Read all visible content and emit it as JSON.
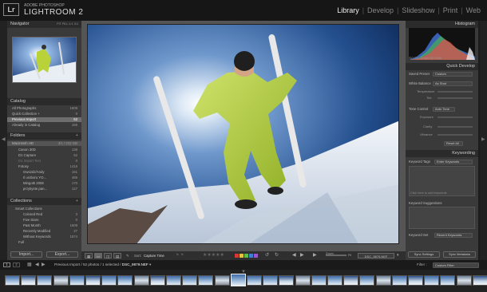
{
  "app": {
    "brand_sub": "ADOBE PHOTOSHOP",
    "brand_main": "LIGHTROOM 2",
    "logo": "Lr"
  },
  "modules": [
    "Library",
    "Develop",
    "Slideshow",
    "Print",
    "Web"
  ],
  "left_panel": {
    "navigator": {
      "title": "Navigator",
      "zoom_options": "FIT FILL 1:1 3:1"
    },
    "catalog": {
      "title": "Catalog",
      "items": [
        {
          "label": "All Photographs",
          "count": "1609"
        },
        {
          "label": "Quick Collection +",
          "count": "0"
        },
        {
          "label": "Previous Import",
          "count": "52"
        },
        {
          "label": "Already in Catalog",
          "count": "168"
        }
      ]
    },
    "folders": {
      "title": "Folders",
      "volume": {
        "label": "Macintosh HD",
        "info": "3/1 / 232 GB"
      },
      "items": [
        {
          "label": "Canon 30D",
          "count": "138"
        },
        {
          "label": "D1 Capture",
          "count": "52"
        },
        {
          "label": "D1 Import Test",
          "count": "0"
        },
        {
          "label": "Fotosy",
          "count": "1416"
        },
        {
          "label": "Gwozdz/Andy",
          "count": "161"
        },
        {
          "label": "Il uroboru YO...",
          "count": "486"
        },
        {
          "label": "Mingotti 2008",
          "count": "170"
        },
        {
          "label": "przykyste.pan...",
          "count": "127"
        }
      ]
    },
    "collections": {
      "title": "Collections",
      "items": [
        {
          "label": "Smart Collections",
          "count": ""
        },
        {
          "label": "Colored Red",
          "count": "3"
        },
        {
          "label": "Five Stars",
          "count": "0"
        },
        {
          "label": "Past Month",
          "count": "1609"
        },
        {
          "label": "Recently Modified",
          "count": "27"
        },
        {
          "label": "Without Keywords",
          "count": "1574"
        },
        {
          "label": "Full",
          "count": ""
        }
      ]
    },
    "import_button": "Import...",
    "export_button": "Export..."
  },
  "right_panel": {
    "histogram": {
      "title": "Histogram",
      "info": "ISO 200   24 mm   f/10   1/250"
    },
    "quick_develop": {
      "title": "Quick Develop",
      "saved_preset_label": "Saved Preset",
      "saved_preset_value": "Custom",
      "white_balance_label": "White Balance",
      "white_balance_value": "As Shot",
      "temperature_label": "Temperature",
      "tint_label": "Tint",
      "tone_control_label": "Tone Control",
      "auto_tone": "Auto Tone",
      "exposure_label": "Exposure",
      "clarity_label": "Clarity",
      "vibrance_label": "Vibrance",
      "reset_all": "Reset All"
    },
    "keywording": {
      "title": "Keywording",
      "keyword_tags_label": "Keyword Tags",
      "keyword_tags_value": "Enter Keywords",
      "add_keywords_placeholder": "Click here to add keywords",
      "keyword_suggestions_label": "Keyword Suggestions",
      "keyword_set_label": "Keyword Set",
      "keyword_set_value": "Recent Keywords"
    },
    "sync_settings": "Sync Settings",
    "sync_metadata": "Sync Metadata"
  },
  "toolbar": {
    "sort_label": "Sort:",
    "sort_value": "Capture Time",
    "zoom_label": "Zoom",
    "zoom_value": "Fit",
    "filename": "DSC_9879.NEF",
    "color_labels": [
      "#d23a3a",
      "#e3c33b",
      "#5dbb4a",
      "#3d7fd4",
      "#9a57c9"
    ]
  },
  "filmstrip": {
    "page1": "1",
    "page2": "2",
    "breadcrumb": "Previous Import / 52 photos / 1 selected / ",
    "selected_file": "DSC_9879.NEF",
    "filter_label": "Filter :",
    "filter_value": "Custom Filter",
    "thumbnail_count": 30
  }
}
